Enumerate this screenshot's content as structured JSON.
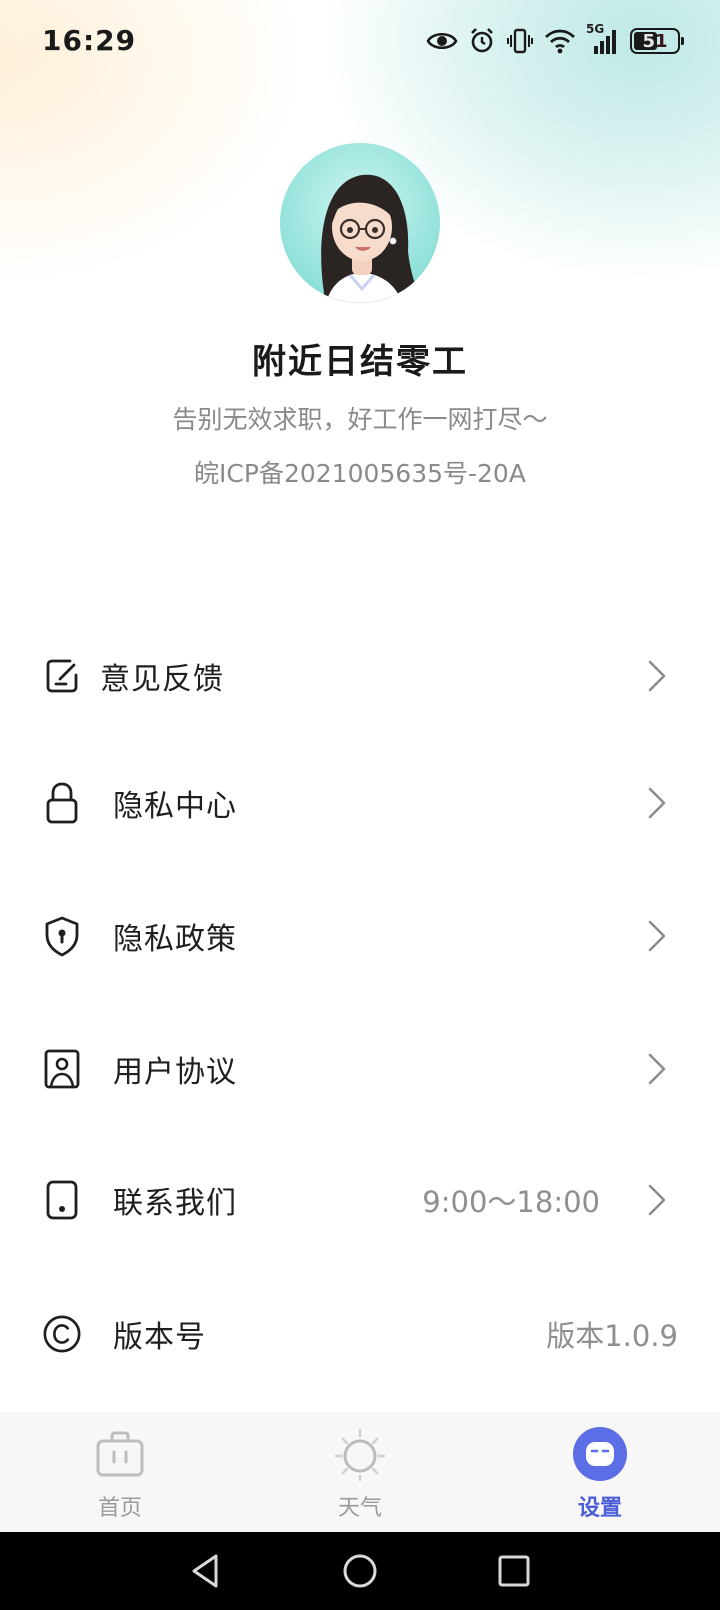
{
  "status_bar": {
    "time": "16:29",
    "network": "5G",
    "battery": "51"
  },
  "profile": {
    "title": "附近日结零工",
    "slogan": "告别无效求职，好工作一网打尽～",
    "icp": "皖ICP备2021005635号-20A"
  },
  "menu": [
    {
      "label": "意见反馈",
      "value": "",
      "icon": "feedback-icon"
    },
    {
      "label": "隐私中心",
      "value": "",
      "icon": "lock-icon"
    },
    {
      "label": "隐私政策",
      "value": "",
      "icon": "shield-icon"
    },
    {
      "label": "用户协议",
      "value": "",
      "icon": "user-agreement-icon"
    },
    {
      "label": "联系我们",
      "value": "9:00～18:00",
      "icon": "phone-icon"
    },
    {
      "label": "版本号",
      "value": "版本1.0.9",
      "icon": "copyright-icon"
    }
  ],
  "tabs": [
    {
      "label": "首页",
      "icon": "briefcase-icon",
      "active": false
    },
    {
      "label": "天气",
      "icon": "sun-icon",
      "active": false
    },
    {
      "label": "设置",
      "icon": "settings-face-icon",
      "active": true
    }
  ],
  "colors": {
    "accent": "#4a5ed7",
    "text": "#1f1f1f",
    "muted": "#8a8a8a"
  }
}
